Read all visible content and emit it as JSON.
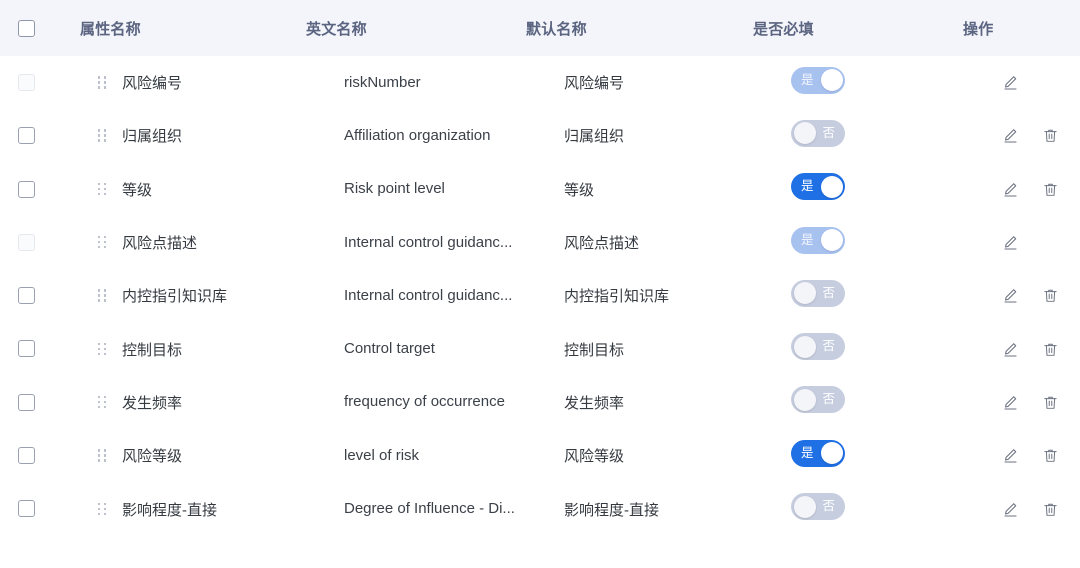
{
  "table": {
    "columns": [
      {
        "key": "checkbox",
        "label": ""
      },
      {
        "key": "name",
        "label": "属性名称"
      },
      {
        "key": "english",
        "label": "英文名称"
      },
      {
        "key": "default",
        "label": "默认名称"
      },
      {
        "key": "required",
        "label": "是否必填"
      },
      {
        "key": "action",
        "label": "操作"
      }
    ],
    "header_select_all_checked": false,
    "toggle_labels": {
      "on": "是",
      "off": "否"
    },
    "icons": {
      "drag": "drag-handle-icon",
      "edit": "edit-pencil-icon",
      "delete": "trash-delete-icon",
      "checkbox": "checkbox-icon"
    },
    "colors": {
      "header_bg": "#f3f5fa",
      "header_text": "#5b6480",
      "row_bg": "#ffffff",
      "toggle_on": "#1f6fe5",
      "toggle_on_disabled": "#a8c2f0",
      "toggle_off": "#c6cddf",
      "text": "#343a40",
      "icon": "#6b7280"
    },
    "rows": [
      {
        "checked": false,
        "disabled": true,
        "name": "风险编号",
        "english": "riskNumber",
        "default": "风险编号",
        "required": true,
        "required_label": "是",
        "required_disabled": true,
        "can_edit": true,
        "can_delete": false
      },
      {
        "checked": false,
        "disabled": false,
        "name": "归属组织",
        "english": "Affiliation organization",
        "default": "归属组织",
        "required": false,
        "required_label": "否",
        "required_disabled": false,
        "can_edit": true,
        "can_delete": true
      },
      {
        "checked": false,
        "disabled": false,
        "name": "等级",
        "english": "Risk point level",
        "default": "等级",
        "required": true,
        "required_label": "是",
        "required_disabled": false,
        "can_edit": true,
        "can_delete": true
      },
      {
        "checked": false,
        "disabled": true,
        "name": "风险点描述",
        "english": "Internal control guidanc...",
        "default": "风险点描述",
        "required": true,
        "required_label": "是",
        "required_disabled": true,
        "can_edit": true,
        "can_delete": false
      },
      {
        "checked": false,
        "disabled": false,
        "name": "内控指引知识库",
        "english": "Internal control guidanc...",
        "default": "内控指引知识库",
        "required": false,
        "required_label": "否",
        "required_disabled": false,
        "can_edit": true,
        "can_delete": true
      },
      {
        "checked": false,
        "disabled": false,
        "name": "控制目标",
        "english": "Control target",
        "default": "控制目标",
        "required": false,
        "required_label": "否",
        "required_disabled": false,
        "can_edit": true,
        "can_delete": true
      },
      {
        "checked": false,
        "disabled": false,
        "name": "发生频率",
        "english": "frequency of occurrence",
        "default": "发生频率",
        "required": false,
        "required_label": "否",
        "required_disabled": false,
        "can_edit": true,
        "can_delete": true
      },
      {
        "checked": false,
        "disabled": false,
        "name": "风险等级",
        "english": "level of risk",
        "default": "风险等级",
        "required": true,
        "required_label": "是",
        "required_disabled": false,
        "can_edit": true,
        "can_delete": true
      },
      {
        "checked": false,
        "disabled": false,
        "name": "影响程度-直接",
        "english": "Degree of Influence - Di...",
        "default": "影响程度-直接",
        "required": false,
        "required_label": "否",
        "required_disabled": false,
        "can_edit": true,
        "can_delete": true
      }
    ]
  }
}
